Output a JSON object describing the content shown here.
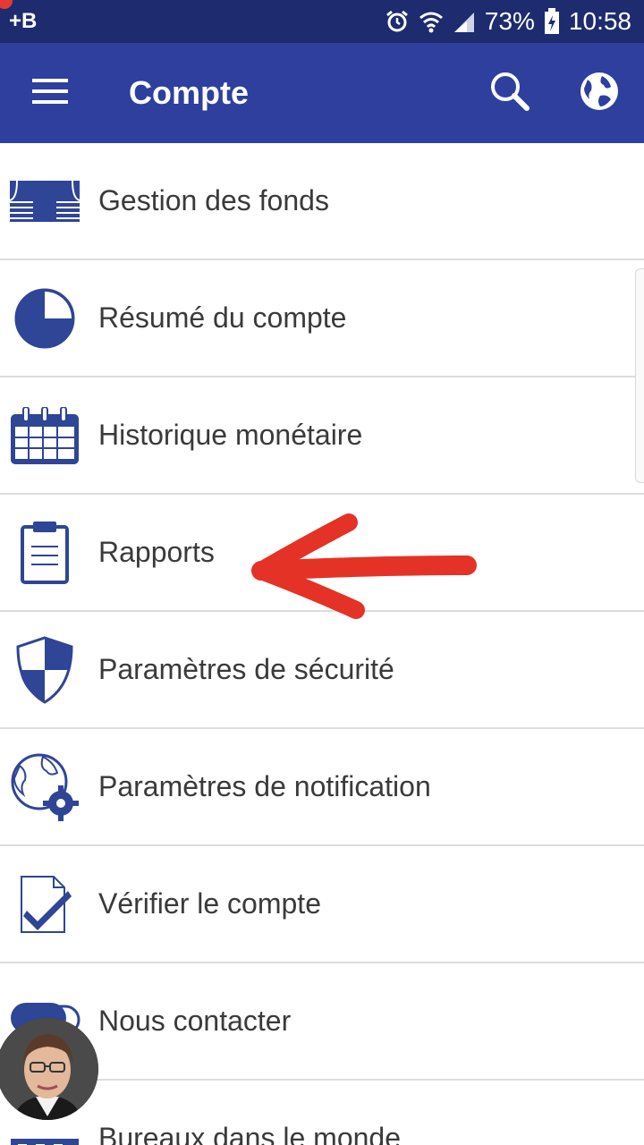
{
  "status_bar": {
    "notification_text": "+B",
    "battery": "73%",
    "time": "10:58",
    "icons": [
      "alarm-icon",
      "wifi-icon",
      "signal-icon",
      "battery-icon"
    ]
  },
  "app_bar": {
    "title": "Compte",
    "menu_icon": "hamburger-menu-icon",
    "actions": [
      "search-icon",
      "globe-icon"
    ]
  },
  "menu": {
    "items": [
      {
        "label": "Gestion des fonds",
        "icon": "money-stack-icon"
      },
      {
        "label": "Résumé du compte",
        "icon": "pie-chart-icon"
      },
      {
        "label": "Historique monétaire",
        "icon": "calendar-icon"
      },
      {
        "label": "Rapports",
        "icon": "clipboard-icon"
      },
      {
        "label": "Paramètres de sécurité",
        "icon": "shield-icon"
      },
      {
        "label": "Paramètres de notification",
        "icon": "globe-gear-icon"
      },
      {
        "label": "Vérifier le compte",
        "icon": "checkmark-document-icon"
      },
      {
        "label": "Nous contacter",
        "icon": "chat-bubble-icon"
      },
      {
        "label": "Bureaux dans le monde",
        "icon": "building-icon"
      }
    ]
  },
  "colors": {
    "status_bar": "#1e2b6e",
    "app_bar": "#2e3f9e",
    "icon_blue": "#2f4596",
    "annotation_red": "#e53226"
  }
}
